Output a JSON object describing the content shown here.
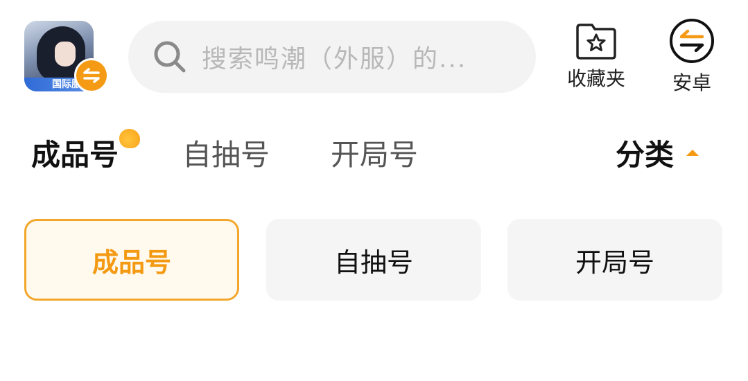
{
  "header": {
    "game_icon": {
      "name": "game-app-icon",
      "region_tag": "国际服"
    },
    "search": {
      "placeholder": "搜索鸣潮（外服）的..."
    },
    "favorites": {
      "label": "收藏夹",
      "icon": "star-folder-icon"
    },
    "platform": {
      "label": "安卓",
      "icon": "switch-arrows-icon"
    }
  },
  "tabs": {
    "items": [
      {
        "label": "成品号",
        "active": true
      },
      {
        "label": "自抽号",
        "active": false
      },
      {
        "label": "开局号",
        "active": false
      }
    ],
    "category_label": "分类"
  },
  "chips": [
    {
      "label": "成品号",
      "selected": true
    },
    {
      "label": "自抽号",
      "selected": false
    },
    {
      "label": "开局号",
      "selected": false
    }
  ],
  "colors": {
    "accent": "#f59a14",
    "selected_bg": "#fff9ee",
    "chip_bg": "#f5f5f5",
    "search_bg": "#f3f3f3"
  }
}
